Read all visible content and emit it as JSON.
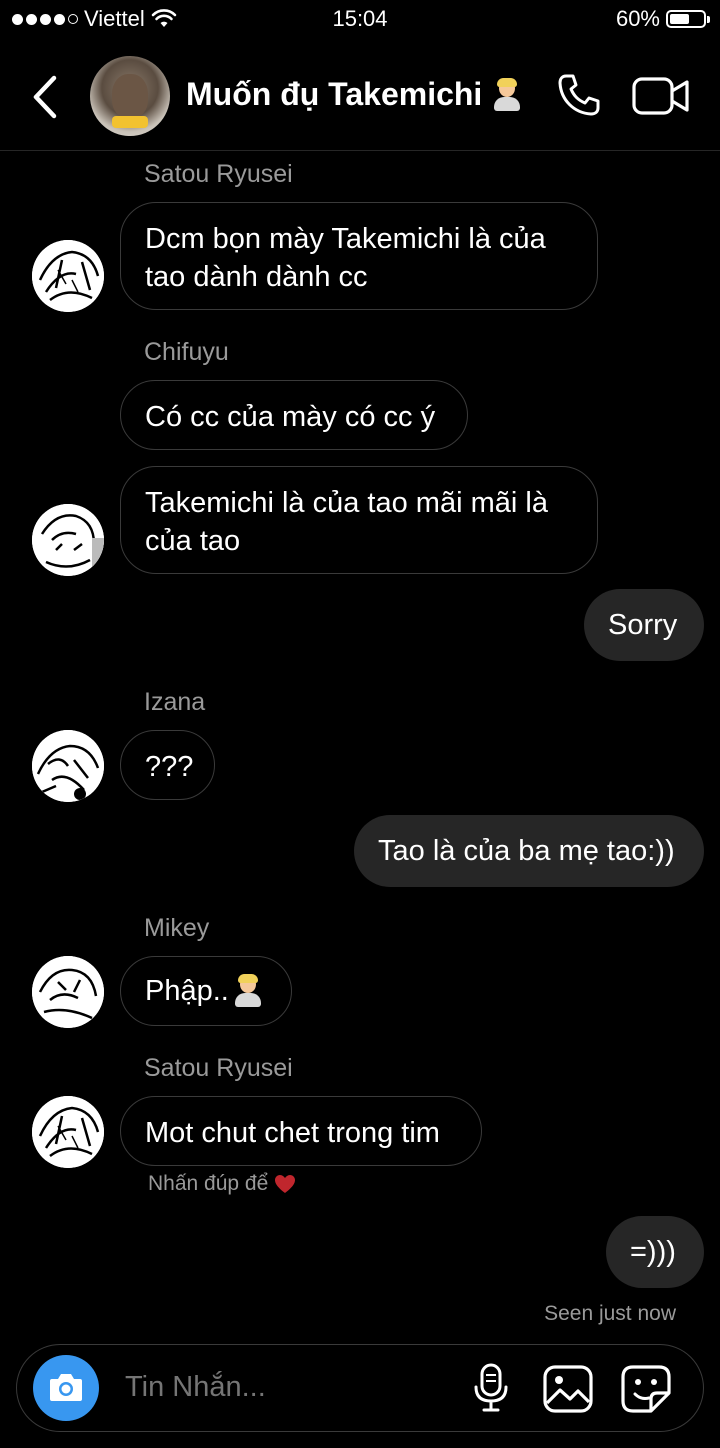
{
  "status_bar": {
    "carrier": "Viettel",
    "time": "15:04",
    "battery": "60%",
    "battery_level": 0.6
  },
  "header": {
    "title": "Muốn đụ Takemichi",
    "icons": [
      "back-chevron-icon",
      "phone-icon",
      "video-camera-icon"
    ]
  },
  "messages": [
    {
      "sender": "Satou Ryusei",
      "text": "Dcm bọn mày Takemichi là của tao dành dành cc"
    },
    {
      "sender": "Chifuyu",
      "text": "Có cc của mày có cc ý"
    },
    {
      "sender": "",
      "text": "Takemichi là của tao mãi mãi là của tao"
    },
    {
      "sender": "me",
      "text": "Sorry"
    },
    {
      "sender": "Izana",
      "text": "???"
    },
    {
      "sender": "me",
      "text": "Tao là của ba mẹ tao:))"
    },
    {
      "sender": "Mikey",
      "text": "Phập.."
    },
    {
      "sender": "Satou Ryusei",
      "text": "Mot chut chet trong tim"
    },
    {
      "sender": "me",
      "text": "=)))"
    }
  ],
  "double_tap_hint": "Nhấn đúp để",
  "seen_status": "Seen just now",
  "composer": {
    "placeholder": "Tin Nhắn...",
    "icons": [
      "camera-icon",
      "microphone-icon",
      "gallery-icon",
      "sticker-icon"
    ]
  },
  "colors": {
    "background": "#000000",
    "outgoing_bubble": "#262626",
    "incoming_border": "#3a3a3a",
    "camera_button": "#3897f0",
    "secondary_text": "#9a9a9a",
    "heart": "#c0262d"
  }
}
